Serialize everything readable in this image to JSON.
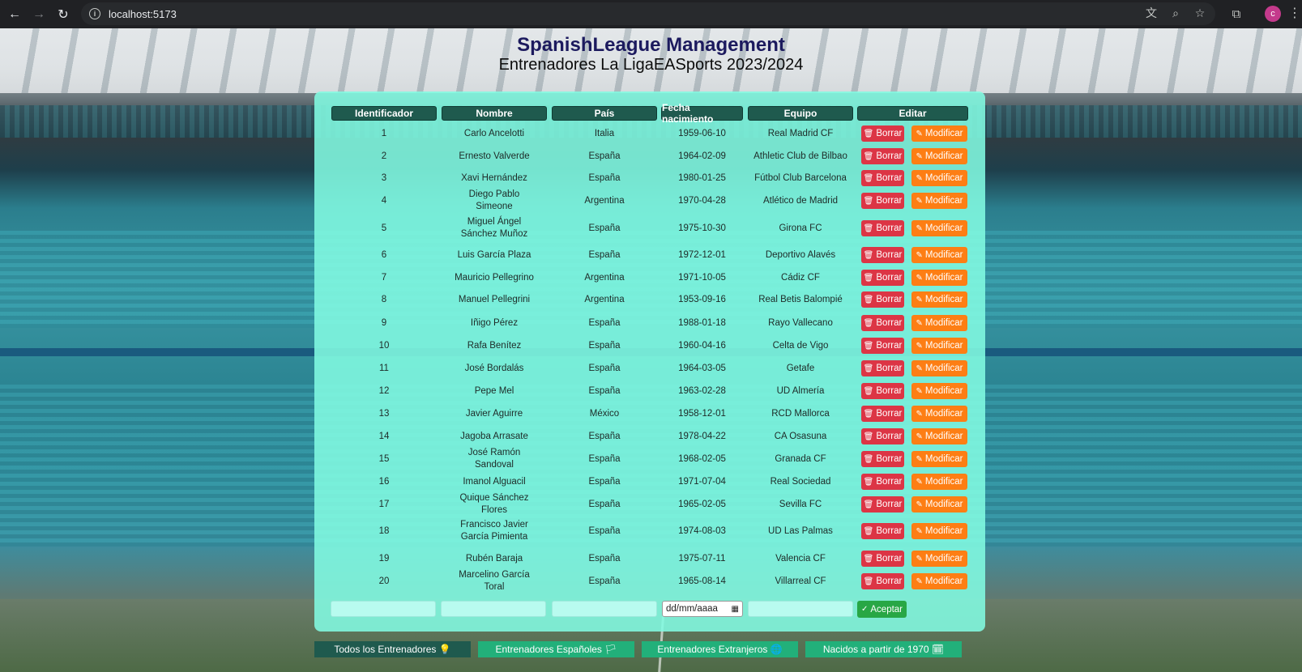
{
  "browser": {
    "url": "localhost:5173",
    "profile_initial": "c"
  },
  "header": {
    "title": "SpanishLeague Management",
    "subtitle": "Entrenadores La LigaEASports 2023/2024"
  },
  "table": {
    "columns": [
      "Identificador",
      "Nombre",
      "País",
      "Fecha nacimiento",
      "Equipo",
      "Editar"
    ],
    "delete_label": "Borrar",
    "modify_label": "Modificar",
    "rows": [
      {
        "id": "1",
        "name": "Carlo Ancelotti",
        "country": "Italia",
        "birth": "1959-06-10",
        "team": "Real Madrid CF"
      },
      {
        "id": "2",
        "name": "Ernesto Valverde",
        "country": "España",
        "birth": "1964-02-09",
        "team": "Athletic Club de Bilbao"
      },
      {
        "id": "3",
        "name": "Xavi Hernández",
        "country": "España",
        "birth": "1980-01-25",
        "team": "Fútbol Club Barcelona"
      },
      {
        "id": "4",
        "name": "Diego Pablo Simeone",
        "country": "Argentina",
        "birth": "1970-04-28",
        "team": "Atlético de Madrid"
      },
      {
        "id": "5",
        "name": "Miguel Ángel Sánchez Muñoz",
        "country": "España",
        "birth": "1975-10-30",
        "team": "Girona FC"
      },
      {
        "id": "6",
        "name": "Luis García Plaza",
        "country": "España",
        "birth": "1972-12-01",
        "team": "Deportivo Alavés"
      },
      {
        "id": "7",
        "name": "Mauricio Pellegrino",
        "country": "Argentina",
        "birth": "1971-10-05",
        "team": "Cádiz CF"
      },
      {
        "id": "8",
        "name": "Manuel Pellegrini",
        "country": "Argentina",
        "birth": "1953-09-16",
        "team": "Real Betis Balompié"
      },
      {
        "id": "9",
        "name": "Iñigo Pérez",
        "country": "España",
        "birth": "1988-01-18",
        "team": "Rayo Vallecano"
      },
      {
        "id": "10",
        "name": "Rafa Benítez",
        "country": "España",
        "birth": "1960-04-16",
        "team": "Celta de Vigo"
      },
      {
        "id": "11",
        "name": "José Bordalás",
        "country": "España",
        "birth": "1964-03-05",
        "team": "Getafe"
      },
      {
        "id": "12",
        "name": "Pepe Mel",
        "country": "España",
        "birth": "1963-02-28",
        "team": "UD Almería"
      },
      {
        "id": "13",
        "name": "Javier Aguirre",
        "country": "México",
        "birth": "1958-12-01",
        "team": "RCD Mallorca"
      },
      {
        "id": "14",
        "name": "Jagoba Arrasate",
        "country": "España",
        "birth": "1978-04-22",
        "team": "CA Osasuna"
      },
      {
        "id": "15",
        "name": "José Ramón Sandoval",
        "country": "España",
        "birth": "1968-02-05",
        "team": "Granada CF"
      },
      {
        "id": "16",
        "name": "Imanol Alguacil",
        "country": "España",
        "birth": "1971-07-04",
        "team": "Real Sociedad"
      },
      {
        "id": "17",
        "name": "Quique Sánchez Flores",
        "country": "España",
        "birth": "1965-02-05",
        "team": "Sevilla FC"
      },
      {
        "id": "18",
        "name": "Francisco Javier García Pimienta",
        "country": "España",
        "birth": "1974-08-03",
        "team": "UD Las Palmas"
      },
      {
        "id": "19",
        "name": "Rubén Baraja",
        "country": "España",
        "birth": "1975-07-11",
        "team": "Valencia CF"
      },
      {
        "id": "20",
        "name": "Marcelino García Toral",
        "country": "España",
        "birth": "1965-08-14",
        "team": "Villarreal CF"
      }
    ]
  },
  "form": {
    "date_placeholder": "dd/mm/aaaa",
    "accept_label": "Aceptar"
  },
  "nav": [
    {
      "label": "Todos los Entrenadores 💡"
    },
    {
      "label": "Entrenadores Españoles 🏳"
    },
    {
      "label": "Entrenadores Extranjeros 🌐"
    },
    {
      "label": "Nacidos a partir de 1970 🗓"
    }
  ]
}
